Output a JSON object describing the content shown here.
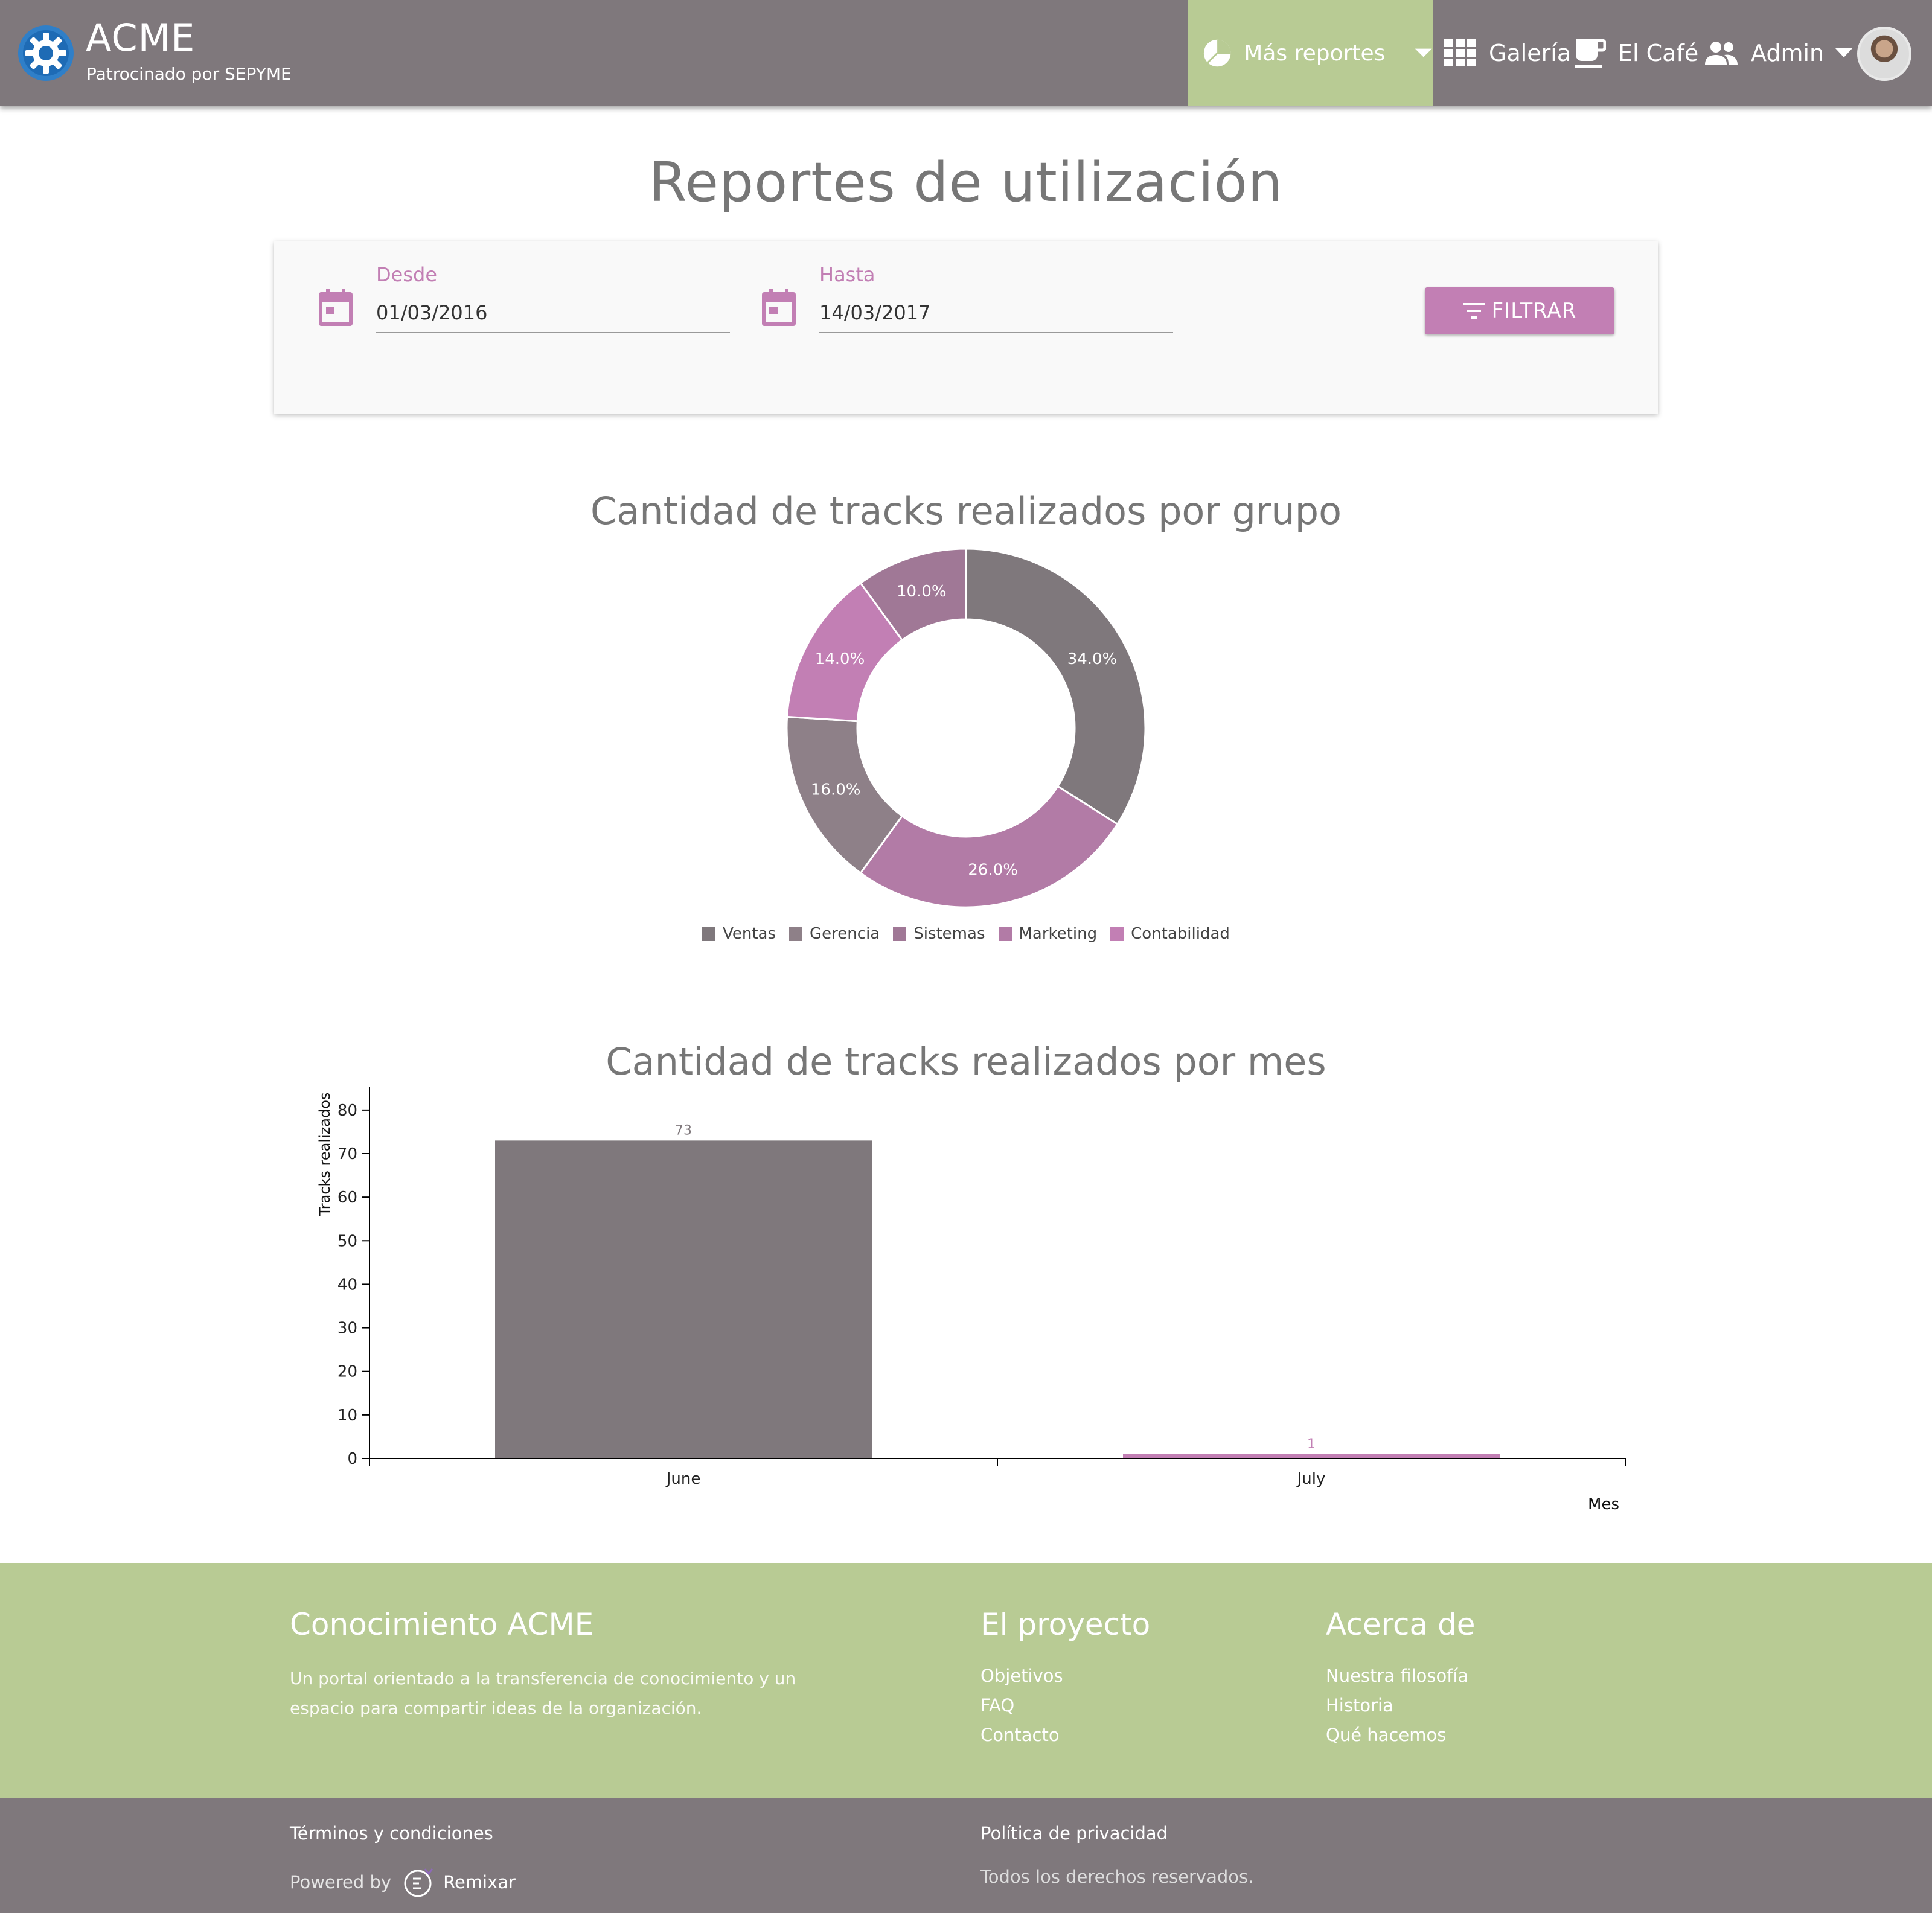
{
  "header": {
    "brand_title": "ACME",
    "brand_subtitle": "Patrocinado por SEPYME",
    "nav": {
      "reports_label": "Más reportes",
      "gallery_label": "Galería",
      "cafe_label": "El Café",
      "admin_label": "Admin"
    },
    "icons": [
      "gear-logo-icon",
      "pie-chart-icon",
      "chevron-down-icon",
      "grid-icon",
      "coffee-icon",
      "people-icon",
      "avatar"
    ]
  },
  "page": {
    "title": "Reportes de utilización"
  },
  "filter": {
    "from_label": "Desde",
    "from_value": "01/03/2016",
    "to_label": "Hasta",
    "to_value": "14/03/2017",
    "button_label": "FILTRAR"
  },
  "colors": {
    "header_bg": "#7f787c",
    "accent_green": "#b8cb94",
    "accent_purple": "#c27fb4"
  },
  "charts": {
    "donut_title": "Cantidad de tracks realizados por grupo",
    "bar_title": "Cantidad de tracks realizados por mes"
  },
  "chart_data": [
    {
      "type": "pie",
      "title": "Cantidad de tracks realizados por grupo",
      "donut": true,
      "legend_position": "bottom",
      "slices": [
        {
          "label": "Ventas",
          "value": 34.0,
          "display": "34.0%",
          "color": "#7f787c"
        },
        {
          "label": "Gerencia",
          "value": 26.0,
          "display": "26.0%",
          "color": "#b27ba6"
        },
        {
          "label": "Sistemas",
          "value": 16.0,
          "display": "16.0%",
          "color": "#8e8088"
        },
        {
          "label": "Marketing",
          "value": 14.0,
          "display": "14.0%",
          "color": "#c27fb4"
        },
        {
          "label": "Contabilidad",
          "value": 10.0,
          "display": "10.0%",
          "color": "#a07896"
        }
      ],
      "legend": [
        {
          "label": "Ventas",
          "color": "#7f787c"
        },
        {
          "label": "Gerencia",
          "color": "#8e8088"
        },
        {
          "label": "Sistemas",
          "color": "#a07896"
        },
        {
          "label": "Marketing",
          "color": "#b27ba6"
        },
        {
          "label": "Contabilidad",
          "color": "#c27fb4"
        }
      ]
    },
    {
      "type": "bar",
      "title": "Cantidad de tracks realizados por mes",
      "categories": [
        "June",
        "July"
      ],
      "values": [
        73,
        1
      ],
      "value_labels": [
        "73",
        "1"
      ],
      "colors": [
        "#7f787c",
        "#c27fb4"
      ],
      "xlabel": "Mes",
      "ylabel": "Tracks realizados",
      "ylim": [
        0,
        84
      ],
      "yticks": [
        0,
        10,
        20,
        30,
        40,
        50,
        60,
        70,
        80
      ],
      "grid": false
    }
  ],
  "footer": {
    "col1_title": "Conocimiento ACME",
    "col1_text": "Un portal orientado a la transferencia de conocimiento y un espacio para compartir ideas de la organización.",
    "col2_title": "El proyecto",
    "col2_links": [
      "Objetivos",
      "FAQ",
      "Contacto"
    ],
    "col3_title": "Acerca de",
    "col3_links": [
      "Nuestra filosofía",
      "Historia",
      "Qué hacemos"
    ],
    "terms": "Términos y condiciones",
    "privacy": "Política de privacidad",
    "powered_by": "Powered by",
    "powered_brand": "Remixar",
    "rights": "Todos los derechos reservados."
  }
}
